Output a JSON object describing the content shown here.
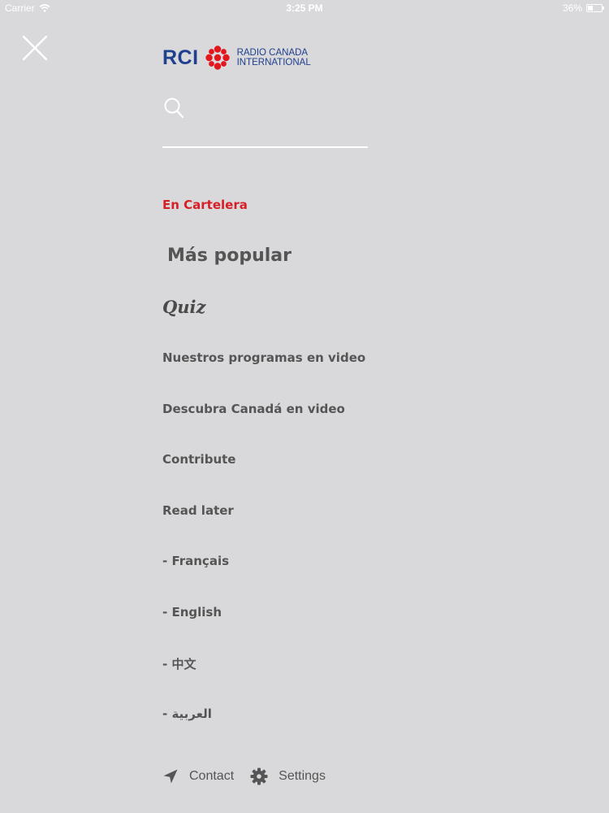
{
  "status_bar": {
    "carrier": "Carrier",
    "time": "3:25 PM",
    "battery_percent": "36%",
    "battery_level": 0.36
  },
  "header": {
    "close_icon": "close-icon",
    "logo": {
      "acronym": "RCI",
      "line1": "RADIO CANADA",
      "line2": "INTERNATIONAL",
      "icon": "cbc-gem-icon",
      "colors": {
        "navy": "#1f3f8f",
        "red": "#e3161e"
      }
    }
  },
  "search": {
    "icon": "search-icon",
    "value": "",
    "placeholder": ""
  },
  "menu": {
    "items": [
      {
        "label": "En Cartelera",
        "active": true
      },
      {
        "label": "Más popular"
      },
      {
        "label": "Quiz"
      },
      {
        "label": "Nuestros programas en video"
      },
      {
        "label": "Descubra Canadá en video"
      },
      {
        "label": "Contribute"
      },
      {
        "label": "Read later"
      },
      {
        "label": "- Français"
      },
      {
        "label": "- English"
      },
      {
        "label": "- 中文"
      },
      {
        "label": "العربية -"
      }
    ]
  },
  "footer": {
    "contact": {
      "label": "Contact",
      "icon": "send-icon"
    },
    "settings": {
      "label": "Settings",
      "icon": "gear-icon"
    }
  },
  "colors": {
    "background": "#d9d9db",
    "active_item": "#d61f26",
    "menu_text": "#555555"
  }
}
